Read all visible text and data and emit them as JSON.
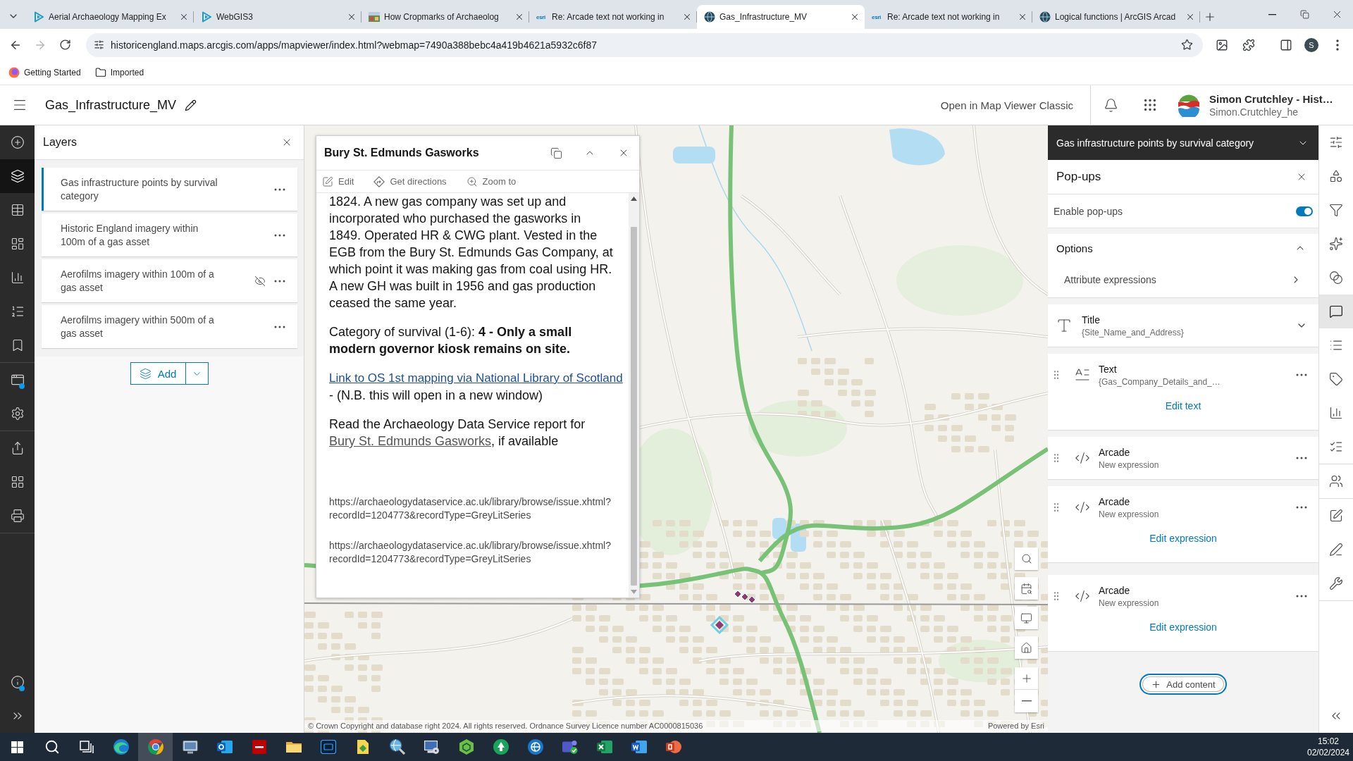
{
  "browser": {
    "tabs": [
      {
        "kind": "webgis",
        "title": "Aerial Archaeology Mapping Ex",
        "selected": false
      },
      {
        "kind": "webgis",
        "title": "WebGIS3",
        "selected": false
      },
      {
        "kind": "thumbnail",
        "title": "How Cropmarks of Archaeolog",
        "selected": false
      },
      {
        "kind": "text",
        "favicon_text": "esri",
        "title": "Re: Arcade text not working in",
        "selected": false
      },
      {
        "kind": "globe",
        "title": "Gas_Infrastructure_MV",
        "selected": true
      },
      {
        "kind": "text",
        "favicon_text": "esri",
        "title": "Re: Arcade text not working in",
        "selected": false
      },
      {
        "kind": "globe",
        "title": "Logical functions | ArcGIS Arcad",
        "selected": false
      }
    ],
    "navigation": {
      "back_disabled": false,
      "forward_disabled": true
    },
    "address": "historicengland.maps.arcgis.com/apps/mapviewer/index.html?webmap=7490a388bebc4a419b4621a5932c6f87",
    "profile_initial": "S",
    "bookmarks": [
      {
        "kind": "site",
        "label": "Getting Started"
      },
      {
        "kind": "folder",
        "label": "Imported"
      }
    ]
  },
  "app_header": {
    "title": "Gas_Infrastructure_MV",
    "classic_link": "Open in Map Viewer Classic",
    "user_name": "Simon Crutchley - Hist…",
    "user_account": "Simon.Crutchley_he"
  },
  "left_toolbar": {
    "groups": [
      {
        "items": [
          {
            "kind": "add",
            "selected": false,
            "dot": false
          },
          {
            "kind": "layers",
            "selected": true,
            "dot": false
          },
          {
            "kind": "table",
            "selected": false,
            "dot": false
          },
          {
            "kind": "dashboard",
            "selected": false,
            "dot": false
          },
          {
            "kind": "chart",
            "selected": false,
            "dot": false
          },
          {
            "kind": "legend",
            "selected": false,
            "dot": false
          },
          {
            "kind": "bookmark",
            "selected": false,
            "dot": false
          }
        ]
      },
      {
        "items": [
          {
            "kind": "window",
            "selected": false,
            "dot": true
          },
          {
            "kind": "settings",
            "selected": false,
            "dot": false
          }
        ]
      },
      {
        "items": [
          {
            "kind": "share",
            "selected": false,
            "dot": false
          },
          {
            "kind": "grid",
            "selected": false,
            "dot": false
          },
          {
            "kind": "print",
            "selected": false,
            "dot": false
          }
        ]
      }
    ],
    "bottom": [
      {
        "kind": "info",
        "selected": false,
        "dot": true
      },
      {
        "kind": "expand",
        "selected": false,
        "dot": false
      }
    ]
  },
  "layers_panel": {
    "title": "Layers",
    "layers": [
      {
        "name": "Gas infrastructure points by survival category",
        "selected": true,
        "visible": true
      },
      {
        "name": "Historic England imagery within 100m of a gas asset",
        "selected": false,
        "visible": true
      },
      {
        "name": "Aerofilms imagery within 100m of a gas asset",
        "selected": false,
        "visible": false
      },
      {
        "name": "Aerofilms imagery within 500m of a gas asset",
        "selected": false,
        "visible": true
      }
    ],
    "add_button": "Add"
  },
  "map": {
    "popup": {
      "title": "Bury St. Edmunds Gasworks",
      "actions": [
        {
          "kind": "edit",
          "label": "Edit"
        },
        {
          "kind": "directions",
          "label": "Get directions"
        },
        {
          "kind": "zoom",
          "label": "Zoom to"
        }
      ],
      "content": [
        {
          "kind": "text",
          "text": "1824. A new gas company was set up and incorporated who purchased the gasworks in 1849. Operated HR & CWG plant. Vested in the EGB from the Bury St. Edmunds Gas Company, at which point it was making gas from coal using HR. A new GH was built in 1956 and gas production ceased the same year."
        },
        {
          "kind": "text",
          "text": "Category of survival (1-6): **4 - Only a small modern governor kiosk remains on site.**"
        },
        {
          "kind": "link_first",
          "link": "Link to OS 1st mapping via National Library of Scotland",
          "after": " - (N.B. this will open in a new window)"
        },
        {
          "kind": "link_inside",
          "before": "Read the Archaeology Data Service report for ",
          "link": "Bury St. Edmunds Gasworks",
          "after": ", if available"
        },
        {
          "kind": "url",
          "text": "https://archaeologydataservice.ac.uk/library/browse/issue.xhtml?recordId=1204773&recordType=GreyLitSeries"
        },
        {
          "kind": "url",
          "text": "https://archaeologydataservice.ac.uk/library/browse/issue.xhtml?recordId=1204773&recordType=GreyLitSeries"
        }
      ]
    },
    "attribution": "© Crown Copyright and database right 2024. All rights reserved. Ordnance Survey Licence number AC0000815036",
    "powered_by": "Powered by Esri"
  },
  "config_panel": {
    "layer_title": "Gas infrastructure points by survival category",
    "title": "Pop-ups",
    "enable_popups": {
      "label": "Enable pop-ups",
      "on": true
    },
    "options": {
      "label": "Options",
      "expanded": true,
      "items": [
        "Attribute expressions"
      ]
    },
    "elements": [
      {
        "kind": "title",
        "label": "Title",
        "value": "{Site_Name_and_Address}",
        "expanded": false
      },
      {
        "kind": "text",
        "label": "Text",
        "value": "{Gas_Company_Details_and_…",
        "action": "Edit text"
      },
      {
        "kind": "arcade",
        "label": "Arcade",
        "value": "New expression"
      },
      {
        "kind": "arcade",
        "label": "Arcade",
        "value": "New expression",
        "action": "Edit expression"
      },
      {
        "kind": "arcade",
        "label": "Arcade",
        "value": "New expression",
        "action": "Edit expression"
      }
    ],
    "add_button": "Add content"
  },
  "right_toolbar": {
    "groups": [
      {
        "items": [
          {
            "kind": "sliders",
            "selected": false
          },
          {
            "kind": "shapes",
            "selected": false
          },
          {
            "kind": "filter",
            "selected": false
          },
          {
            "kind": "sparkles",
            "selected": false
          },
          {
            "kind": "circles",
            "selected": false
          },
          {
            "kind": "message",
            "selected": true
          },
          {
            "kind": "list",
            "selected": false
          },
          {
            "kind": "tag",
            "selected": false
          },
          {
            "kind": "chart",
            "selected": false
          },
          {
            "kind": "checklist",
            "selected": false
          }
        ]
      },
      {
        "items": [
          {
            "kind": "users",
            "selected": false
          }
        ]
      },
      {
        "items": [
          {
            "kind": "edit",
            "selected": false
          },
          {
            "kind": "pen",
            "selected": false
          },
          {
            "kind": "wrench",
            "selected": false
          }
        ]
      }
    ],
    "bottom": [
      {
        "kind": "collapse",
        "selected": false
      }
    ]
  },
  "taskbar": {
    "apps": [
      {
        "kind": "start",
        "selected": false
      },
      {
        "kind": "search",
        "selected": false
      },
      {
        "kind": "taskview",
        "selected": false
      },
      {
        "kind": "swirl",
        "selected": false
      },
      {
        "kind": "tricolor",
        "selected": true
      },
      {
        "kind": "monitor",
        "selected": false
      },
      {
        "kind": "envelope",
        "selected": false
      },
      {
        "kind": "redtile",
        "selected": false
      },
      {
        "kind": "folder",
        "selected": false
      },
      {
        "kind": "navytile",
        "selected": false
      },
      {
        "kind": "document",
        "selected": false
      },
      {
        "kind": "globesearch",
        "selected": false
      },
      {
        "kind": "computer",
        "selected": false
      },
      {
        "kind": "hexagon",
        "selected": false
      },
      {
        "kind": "greencircle",
        "selected": false
      },
      {
        "kind": "bluecircle",
        "selected": false
      },
      {
        "kind": "people",
        "selected": false
      },
      {
        "kind": "sheet",
        "selected": false
      },
      {
        "kind": "doc",
        "selected": false
      },
      {
        "kind": "slides",
        "selected": false
      }
    ],
    "time": "15:02",
    "date": "02/02/2024"
  }
}
